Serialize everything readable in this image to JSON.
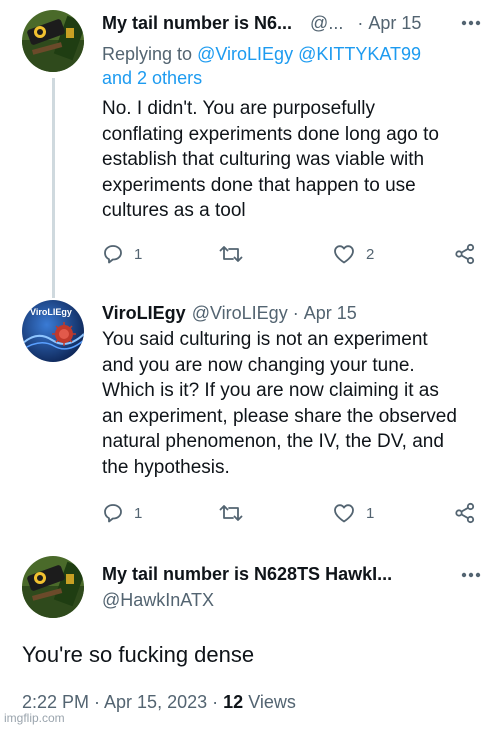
{
  "tweets": [
    {
      "display_name": "My tail number is N6...",
      "handle": "@...",
      "date": "Apr 15",
      "replying_prefix": "Replying to",
      "replying_users": "@ViroLIEgy @KITTYKAT99",
      "replying_others": "and 2 others",
      "text_lines": [
        "No. I didn't. You are purposefully",
        "conflating experiments done long ago to",
        "establish that culturing was viable with",
        "experiments done that happen to use",
        "cultures as a tool"
      ],
      "replies": "1",
      "likes": "2"
    },
    {
      "display_name": "ViroLIEgy",
      "handle": "@ViroLIEgy",
      "date": "Apr 15",
      "avatar_text": "ViroLIEgy",
      "text_lines": [
        "You said culturing is not an experiment",
        "and you are now changing your tune.",
        "Which is it? If you are now claiming it as",
        "an experiment, please share the observed",
        "natural phenomenon, the IV, the DV, and",
        "the hypothesis."
      ],
      "replies": "1",
      "likes": "1"
    }
  ],
  "main": {
    "display_name": "My tail number is N628TS HawkI...",
    "handle": "@HawkInATX",
    "text": "You're so fucking dense",
    "time": "2:22 PM · Apr 15, 2023 ·",
    "views_count": "12",
    "views_label": "Views"
  },
  "watermark": "imgflip.com",
  "colors": {
    "link": "#1d9bf0",
    "muted": "#536471",
    "text": "#0f1419",
    "thread": "#cfd9de"
  },
  "icons": [
    "reply-icon",
    "retweet-icon",
    "like-icon",
    "share-icon",
    "more-icon"
  ]
}
